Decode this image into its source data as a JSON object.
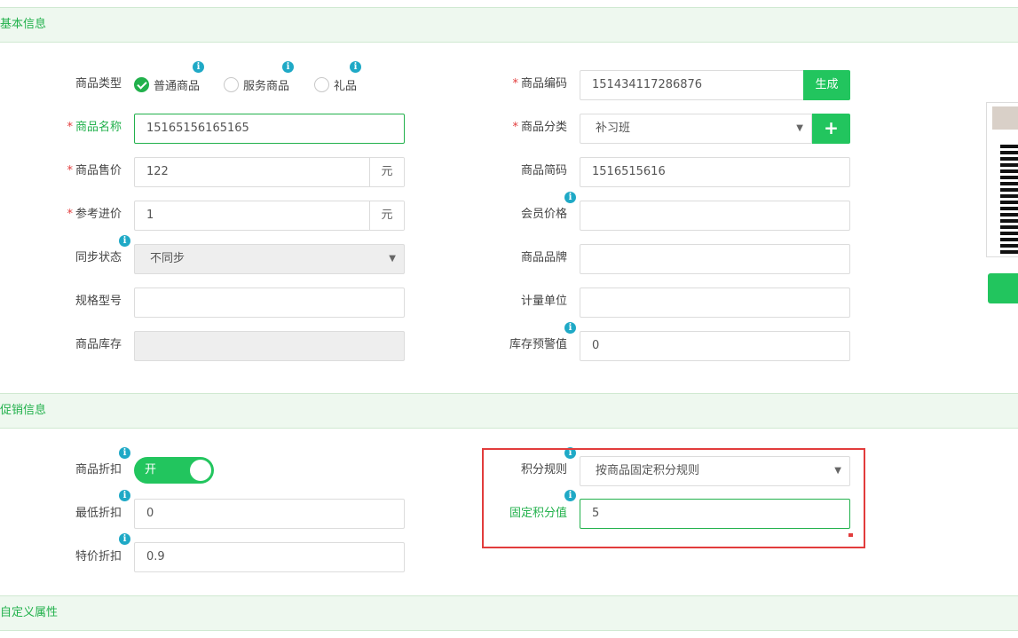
{
  "sections": {
    "basic": "基本信息",
    "promo": "促销信息",
    "custom": "自定义属性"
  },
  "basic": {
    "type_label": "商品类型",
    "type_options": [
      "普通商品",
      "服务商品",
      "礼品"
    ],
    "type_selected": "普通商品",
    "code_label": "商品编码",
    "code_value": "151434117286876",
    "generate_btn": "生成",
    "name_label": "商品名称",
    "name_value": "15165156165165",
    "category_label": "商品分类",
    "category_value": "补习班",
    "add_category_btn": "+",
    "price_label": "商品售价",
    "price_value": "122",
    "price_unit": "元",
    "shortcode_label": "商品简码",
    "shortcode_value": "1516515616",
    "cost_label": "参考进价",
    "cost_value": "1",
    "cost_unit": "元",
    "member_price_label": "会员价格",
    "member_price_value": "",
    "sync_label": "同步状态",
    "sync_value": "不同步",
    "brand_label": "商品品牌",
    "brand_value": "",
    "spec_label": "规格型号",
    "spec_value": "",
    "unit_label": "计量单位",
    "unit_value": "",
    "stock_label": "商品库存",
    "stock_value": "",
    "stock_warn_label": "库存预警值",
    "stock_warn_value": "0"
  },
  "promo": {
    "discount_label": "商品折扣",
    "discount_toggle": "开",
    "points_rule_label": "积分规则",
    "points_rule_value": "按商品固定积分规则",
    "min_discount_label": "最低折扣",
    "min_discount_value": "0",
    "fixed_points_label": "固定积分值",
    "fixed_points_value": "5",
    "special_discount_label": "特价折扣",
    "special_discount_value": "0.9"
  },
  "icons": {
    "info": "i",
    "caret": "▼",
    "add": "+"
  },
  "colors": {
    "accent": "#22c55e",
    "section_bg": "#eef8ef",
    "required": "#e23c3c",
    "info": "#1fa9c6"
  }
}
